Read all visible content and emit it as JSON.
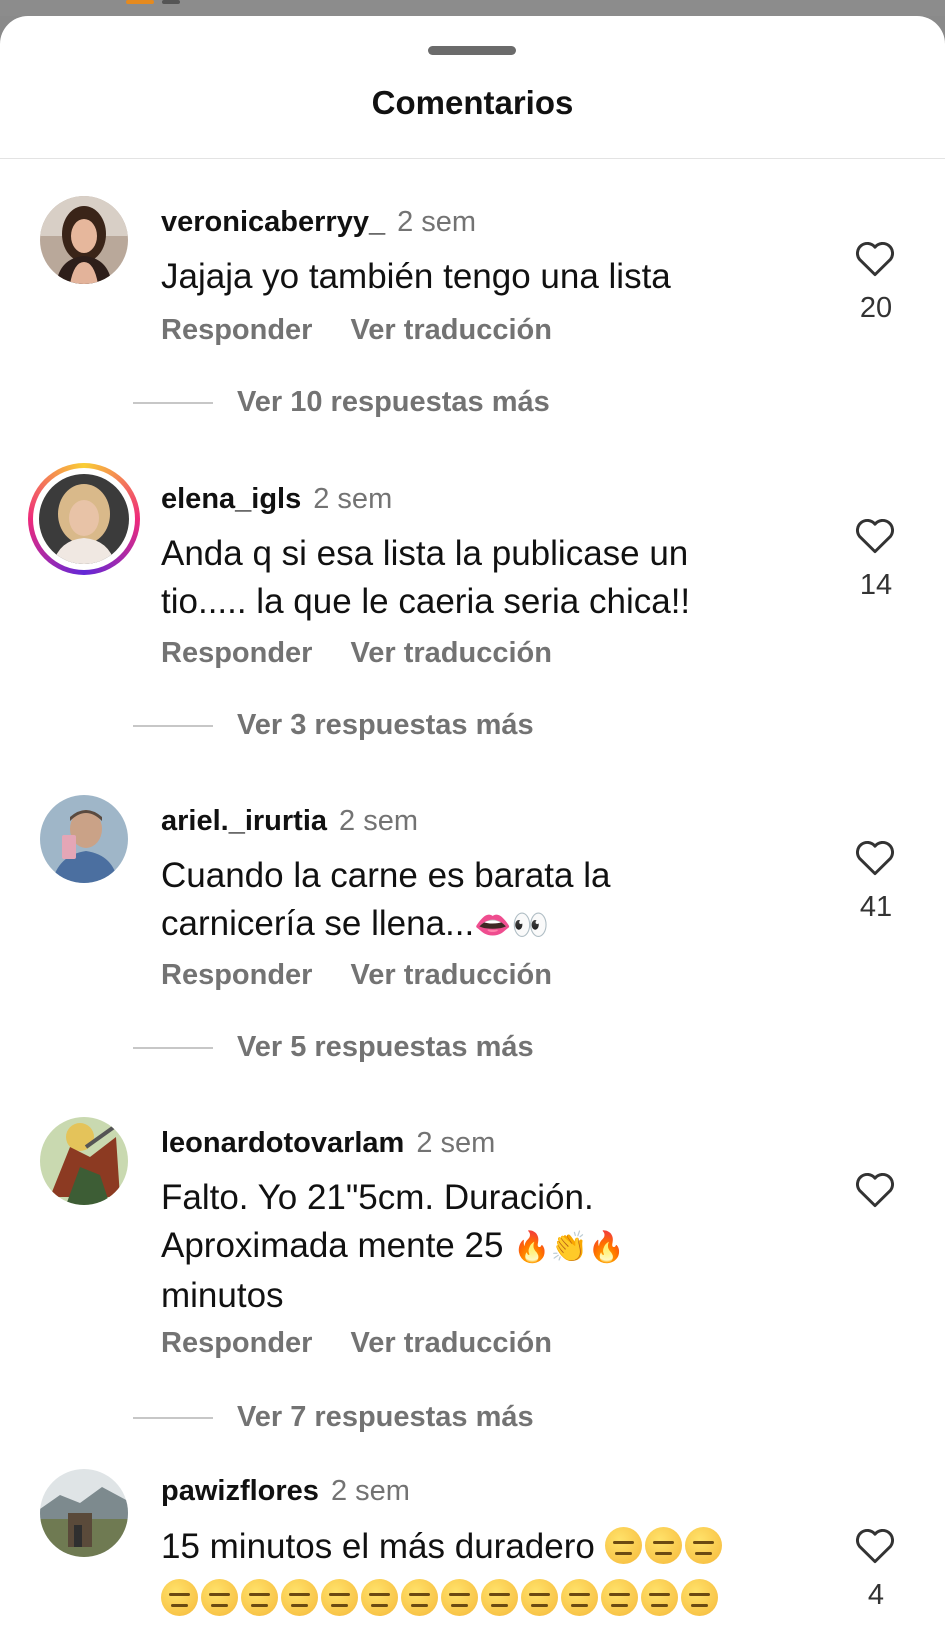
{
  "header": {
    "title": "Comentarios"
  },
  "common": {
    "reply_label": "Responder",
    "translate_label": "Ver traducción"
  },
  "comments": [
    {
      "username": "veronicaberryy_",
      "time": "2 sem",
      "text": "Jajaja yo también tengo una lista",
      "likes": "20",
      "more_replies": "Ver 10 respuestas más",
      "avatar_icon": "woman-portrait-avatar"
    },
    {
      "username": "elena_igls",
      "time": "2 sem",
      "text": "Anda q si esa lista la publicase un tio..... la que le caeria seria chica!!",
      "likes": "14",
      "more_replies": "Ver 3 respuestas más",
      "avatar_icon": "woman-blonde-avatar",
      "has_story": true
    },
    {
      "username": "ariel._irurtia",
      "time": "2 sem",
      "text": "Cuando la carne es barata la carnicería se llena...",
      "emojis": "👄👀",
      "likes": "41",
      "more_replies": "Ver 5 respuestas más",
      "avatar_icon": "man-selfie-avatar"
    },
    {
      "username": "leonardotovarlam",
      "time": "2 sem",
      "text_line1": "Falto. Yo 21\"5cm. Duración.",
      "text_line2": "Aproximada mente 25",
      "emojis": "🔥👏🔥",
      "text_line3": "minutos",
      "likes": "",
      "more_replies": "Ver 7 respuestas más",
      "avatar_icon": "saint-painting-avatar"
    },
    {
      "username": "pawizflores",
      "time": "2 sem",
      "text": "15 minutos el más duradero",
      "emoji_name": "expressionless-face",
      "emoji_count": 17,
      "likes": "4",
      "avatar_icon": "landscape-avatar"
    }
  ],
  "colors": {
    "secondary_text": "#737373",
    "story_ring": "#ee2a7b",
    "sheet_bg": "#ffffff"
  }
}
